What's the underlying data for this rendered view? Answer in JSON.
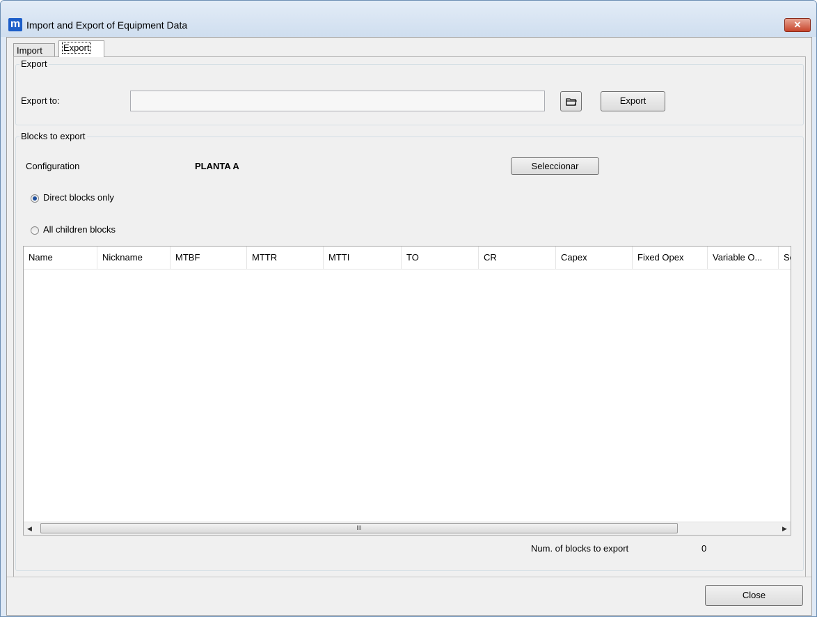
{
  "window": {
    "title": "Import and Export of Equipment Data",
    "app_icon": "m",
    "close_glyph": "✕"
  },
  "tabs": [
    {
      "label": "Import"
    },
    {
      "label": "Export"
    }
  ],
  "export_group": {
    "title": "Export",
    "export_to_label": "Export to:",
    "export_to_value": "",
    "browse_icon": "folder-icon",
    "export_button": "Export"
  },
  "blocks_group": {
    "title": "Blocks to export",
    "configuration_label": "Configuration",
    "configuration_value": "PLANTA A",
    "select_button": "Seleccionar",
    "radio_direct": "Direct blocks only",
    "radio_all": "All children blocks",
    "selected_radio": "direct"
  },
  "table": {
    "columns": [
      "Name",
      "Nickname",
      "MTBF",
      "MTTR",
      "MTTI",
      "TO",
      "CR",
      "Capex",
      "Fixed Opex",
      "Variable O...",
      "Sc"
    ],
    "rows": [],
    "scroll_grip": "III",
    "scroll_left": "◀",
    "scroll_right": "▶"
  },
  "summary": {
    "label": "Num. of blocks to export",
    "count": "0"
  },
  "footer": {
    "close_button": "Close"
  }
}
